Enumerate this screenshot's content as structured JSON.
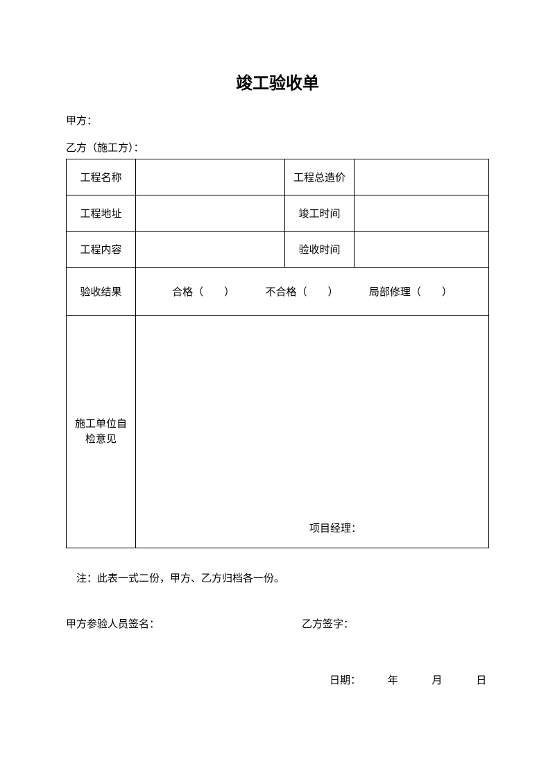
{
  "title": "竣工验收单",
  "partyA": "甲方：",
  "partyB": "乙方（施工方）：",
  "table": {
    "row1": {
      "label1": "工程名称",
      "label2": "工程总造价"
    },
    "row2": {
      "label1": "工程地址",
      "label2": "竣工时间"
    },
    "row3": {
      "label1": "工程内容",
      "label2": "验收时间"
    },
    "resultLabel": "验收结果",
    "resultOptions": {
      "pass": "合格（　　）",
      "fail": "不合格（　　）",
      "partial": "局部修理（　　）"
    },
    "opinionLabel1": "施工单位自",
    "opinionLabel2": "检意见",
    "projectManager": "项目经理："
  },
  "note": "注：此表一式二份，甲方、乙方归档各一份。",
  "sigA": "甲方参验人员签名：",
  "sigB": "乙方签字：",
  "date": {
    "label": "日期：",
    "year": "年",
    "month": "月",
    "day": "日"
  }
}
